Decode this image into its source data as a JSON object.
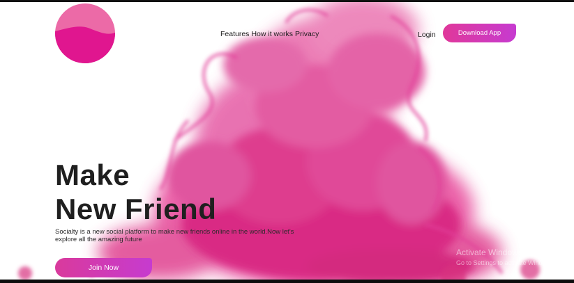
{
  "nav": {
    "links": [
      "Features",
      "How it works",
      "Privacy"
    ],
    "login": "Login",
    "download": "Download App"
  },
  "hero": {
    "headline_line1": "Make",
    "headline_line2": "New Friend",
    "tagline": "Socialty is a new social platform to make new friends online in the world.Now let's explore all the amazing future",
    "cta": "Join Now"
  },
  "watermark": {
    "title": "Activate Windows",
    "subtitle": "Go to Settings to activate Windows."
  },
  "colors": {
    "brand_pink": "#e0389a",
    "brand_purple": "#c63bd0",
    "ink": "#e0358f"
  },
  "icons": [
    "logo-icon"
  ]
}
